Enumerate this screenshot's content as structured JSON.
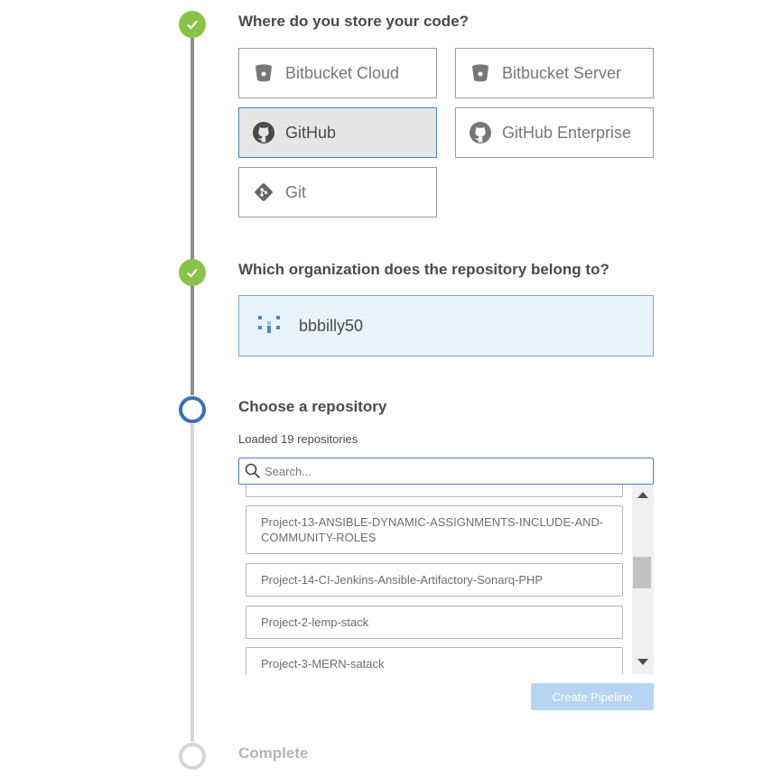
{
  "steps": {
    "store_code": {
      "title": "Where do you store your code?"
    },
    "organization": {
      "title": "Which organization does the repository belong to?"
    },
    "repository": {
      "title": "Choose a repository"
    },
    "complete": {
      "title": "Complete"
    }
  },
  "scm_options": [
    {
      "label": "Bitbucket Cloud",
      "icon": "bitbucket-icon",
      "selected": false
    },
    {
      "label": "Bitbucket Server",
      "icon": "bitbucket-icon",
      "selected": false
    },
    {
      "label": "GitHub",
      "icon": "github-icon",
      "selected": true
    },
    {
      "label": "GitHub Enterprise",
      "icon": "github-icon",
      "selected": false
    },
    {
      "label": "Git",
      "icon": "git-icon",
      "selected": false
    }
  ],
  "organization": {
    "name": "bbbilly50",
    "selected": true
  },
  "repositories": {
    "loaded_text": "Loaded 19 repositories",
    "search_placeholder": "Search...",
    "items": [
      {
        "name": "Project-13-ANSIBLE-DYNAMIC-ASSIGNMENTS-INCLUDE-AND-COMMUNITY-ROLES"
      },
      {
        "name": "Project-14-CI-Jenkins-Ansible-Artifactory-Sonarq-PHP"
      },
      {
        "name": "Project-2-lemp-stack"
      },
      {
        "name": "Project-3-MERN-satack"
      }
    ]
  },
  "actions": {
    "create_pipeline": "Create Pipeline"
  },
  "colors": {
    "step_done": "#8bc34a",
    "step_current": "#3d6fb0",
    "selected_border": "#4a80c7",
    "create_button_disabled": "#b6d4f2"
  }
}
